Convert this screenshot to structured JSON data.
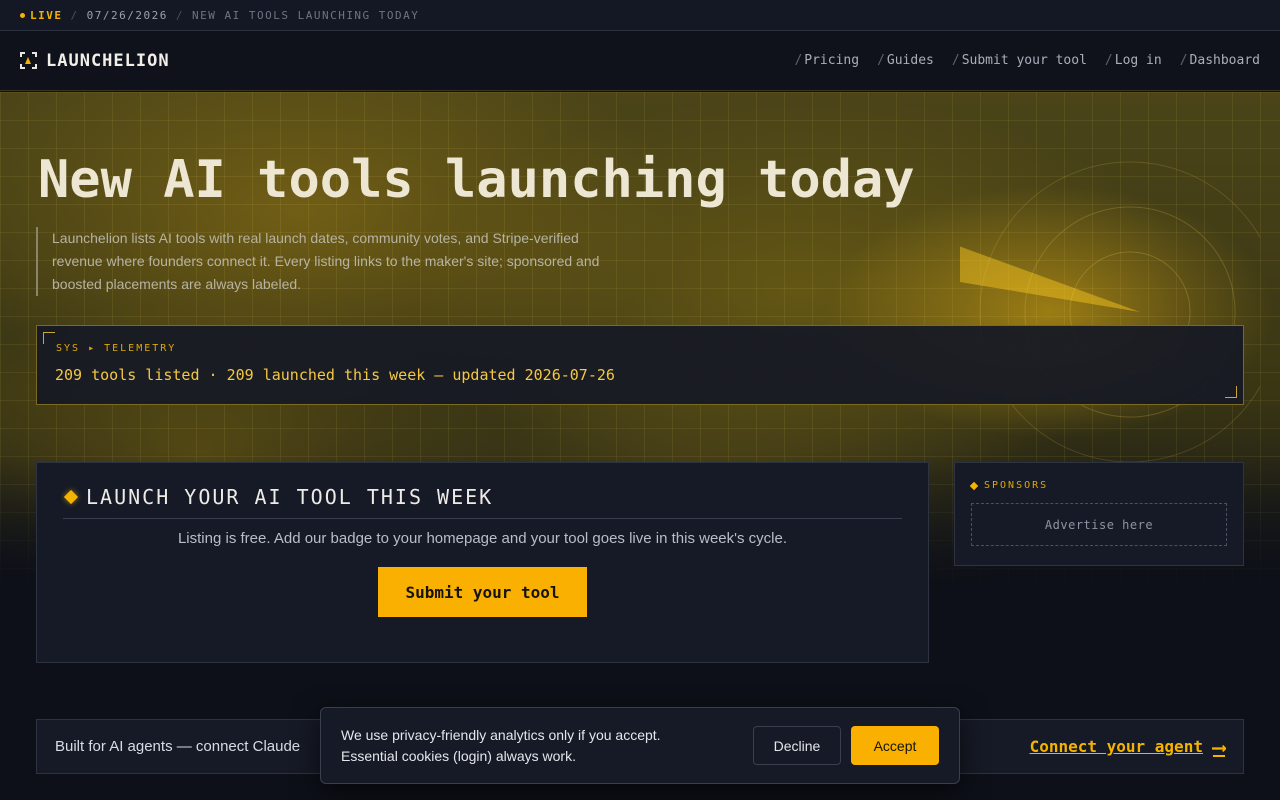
{
  "ticker": {
    "live": "LIVE",
    "date": "07/26/2026",
    "headline": "NEW AI TOOLS LAUNCHING TODAY"
  },
  "nav": {
    "brand": "LAUNCHELION",
    "links": [
      {
        "label": "Pricing"
      },
      {
        "label": "Guides"
      },
      {
        "label": "Submit your tool"
      },
      {
        "label": "Log in"
      },
      {
        "label": "Dashboard"
      }
    ]
  },
  "hero": {
    "title": "New AI tools launching today",
    "description": "Launchelion lists AI tools with real launch dates, community votes, and Stripe-verified revenue where founders connect it. Every listing links to the maker's site; sponsored and boosted placements are always labeled."
  },
  "telemetry": {
    "label": "SYS ▸ TELEMETRY",
    "value": "209 tools listed · 209 launched this week — updated 2026-07-26"
  },
  "launch": {
    "title": "LAUNCH YOUR AI TOOL THIS WEEK",
    "text": "Listing is free. Add our badge to your homepage and your tool goes live in this week's cycle.",
    "button": "Submit your tool"
  },
  "sponsors": {
    "label": "SPONSORS",
    "placeholder": "Advertise here"
  },
  "agents": {
    "text": "Built for AI agents — connect Claude",
    "link": "Connect your agent",
    "arrow": "⟶"
  },
  "cookie": {
    "line1": "We use privacy-friendly analytics only if you accept.",
    "line2": "Essential cookies (login) always work.",
    "decline": "Decline",
    "accept": "Accept"
  },
  "colors": {
    "accent": "#f5b301",
    "background": "#0d1018",
    "panel": "#161a26"
  }
}
